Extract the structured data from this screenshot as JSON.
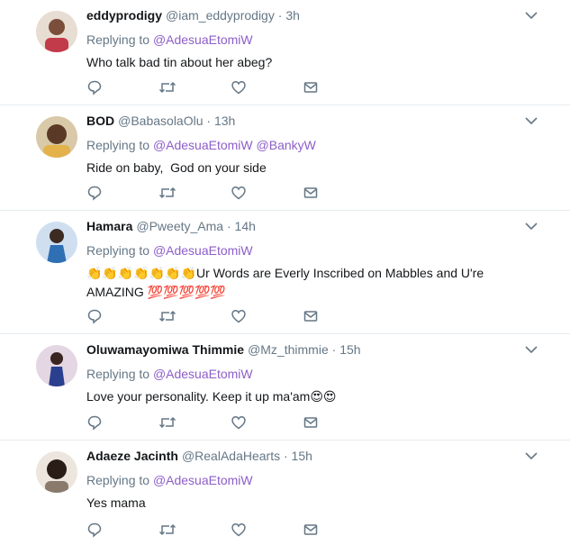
{
  "tweets": [
    {
      "name": "eddyprodigy",
      "handle": "@iam_eddyprodigy",
      "time": "3h",
      "replying_prefix": "Replying to",
      "reply_to": [
        "@AdesuaEtomiW"
      ],
      "text": "Who talk bad tin about her abeg?",
      "avatar_color": "#c9b2a0"
    },
    {
      "name": "BOD",
      "handle": "@BabasolaOlu",
      "time": "13h",
      "replying_prefix": "Replying to",
      "reply_to": [
        "@AdesuaEtomiW",
        "@BankyW"
      ],
      "text": "Ride on baby,  God on your side",
      "avatar_color": "#b7a27a"
    },
    {
      "name": "Hamara",
      "handle": "@Pweety_Ama",
      "time": "14h",
      "replying_prefix": "Replying to",
      "reply_to": [
        "@AdesuaEtomiW"
      ],
      "text_line1": "Ur Words are Everly Inscribed on Mabbles and U're",
      "text_line2": "AMAZING",
      "clap_emoji": "👏👏👏👏👏👏👏",
      "hundred_emoji": "💯💯💯💯💯",
      "avatar_color": "#6f8bb0"
    },
    {
      "name": "Oluwamayomiwa Thimmie",
      "handle": "@Mz_thimmie",
      "time": "15h",
      "replying_prefix": "Replying to",
      "reply_to": [
        "@AdesuaEtomiW"
      ],
      "text": "Love your personality. Keep it up ma'am",
      "heart_eyes_emoji": "😍😍",
      "avatar_color": "#8a6c8f"
    },
    {
      "name": "Adaeze Jacinth",
      "handle": "@RealAdaHearts",
      "time": "15h",
      "replying_prefix": "Replying to",
      "reply_to": [
        "@AdesuaEtomiW"
      ],
      "text": "Yes mama",
      "avatar_color": "#9c8877"
    }
  ],
  "separator": "·",
  "colors": {
    "link": "#8d5ec9",
    "muted": "#657786",
    "icon": "#657786",
    "divider": "#e6ecf0"
  },
  "icons": [
    "reply-icon",
    "retweet-icon",
    "like-icon",
    "direct-message-icon",
    "chevron-down-icon"
  ]
}
